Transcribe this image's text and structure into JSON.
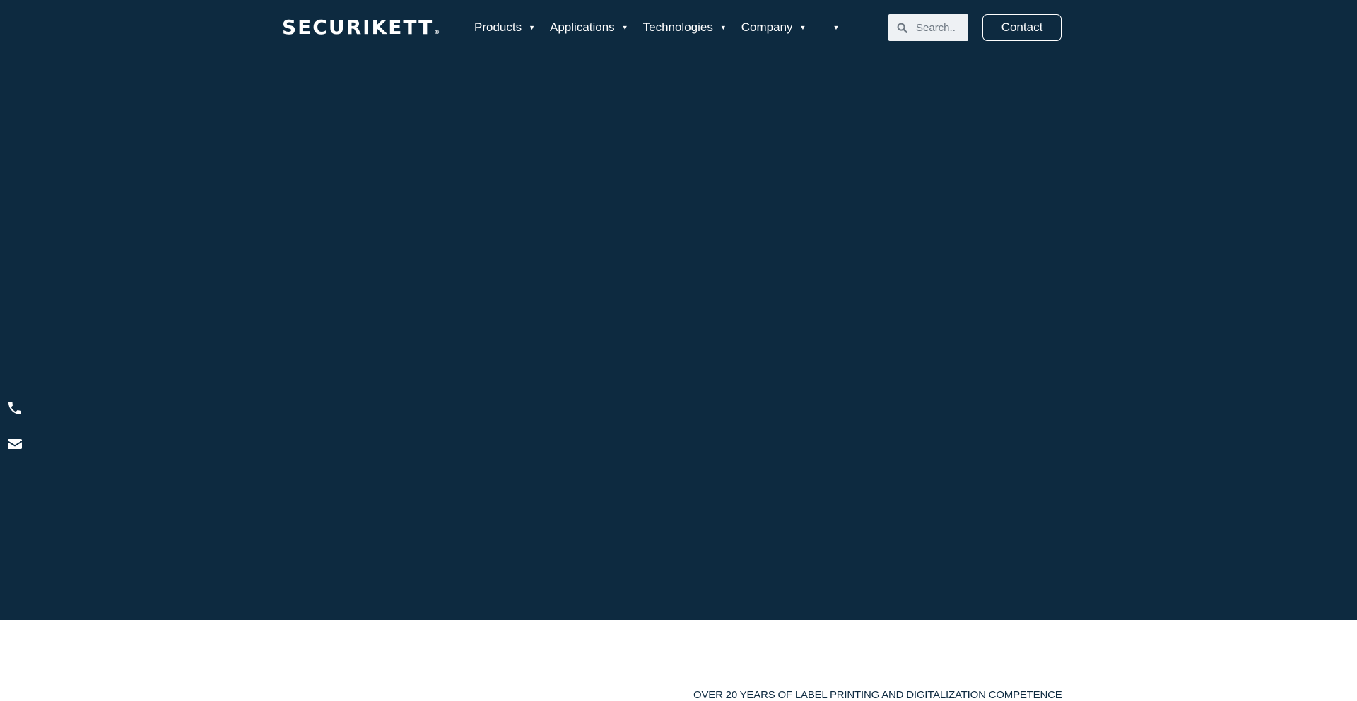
{
  "header": {
    "logo_text": "SECURIKETT",
    "logo_mark": "®",
    "nav": [
      {
        "label": "Products"
      },
      {
        "label": "Applications"
      },
      {
        "label": "Technologies"
      },
      {
        "label": "Company"
      },
      {
        "label": ""
      }
    ],
    "search": {
      "placeholder": "Search..",
      "value": "",
      "icon": "search-icon"
    },
    "contact_label": "Contact"
  },
  "side_contact": {
    "icons": [
      "phone-icon",
      "envelope-icon"
    ]
  },
  "content": {
    "tagline": "OVER 20 YEARS OF LABEL PRINTING AND DIGITALIZATION COMPETENCE"
  },
  "colors": {
    "hero_background": "#0d2a40",
    "text_on_dark": "#ffffff",
    "search_background": "#eef1f4",
    "tagline_text": "#0d2a40"
  }
}
